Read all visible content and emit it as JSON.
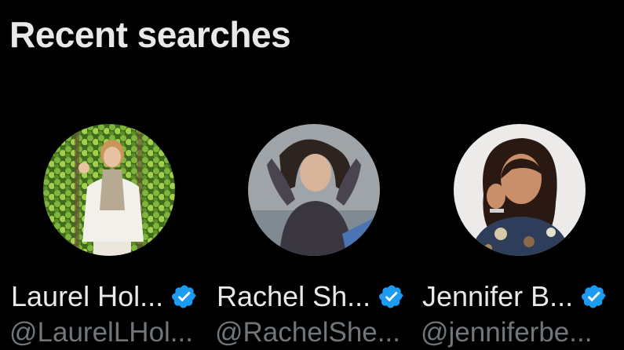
{
  "section": {
    "title": "Recent searches"
  },
  "colors": {
    "background": "#000000",
    "primary_text": "#e7e9ea",
    "secondary_text": "#71767b",
    "verified_badge": "#1d9bf0"
  },
  "recent_searches": [
    {
      "name": "Laurel Hol...",
      "handle": "@LaurelLHol...",
      "verified": true,
      "avatar_icon": "user-avatar"
    },
    {
      "name": "Rachel Sh...",
      "handle": "@RachelShe...",
      "verified": true,
      "avatar_icon": "user-avatar"
    },
    {
      "name": "Jennifer B...",
      "handle": "@jenniferbe...",
      "verified": true,
      "avatar_icon": "user-avatar"
    }
  ]
}
